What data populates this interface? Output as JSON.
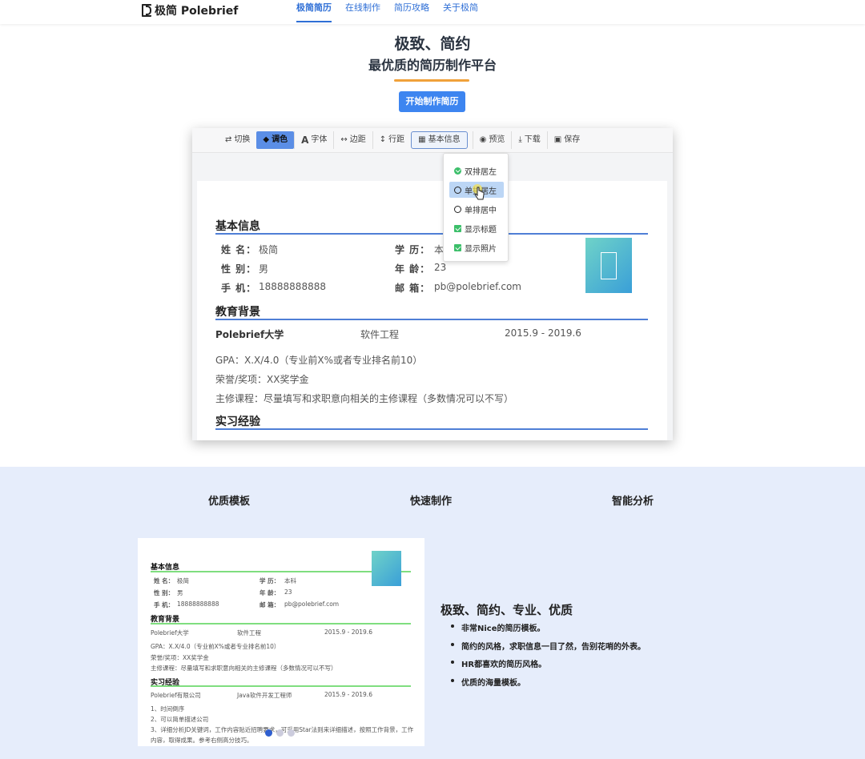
{
  "nav": {
    "logo": "极简 Polebrief",
    "links": [
      "极简简历",
      "在线制作",
      "简历攻略",
      "关于极简"
    ]
  },
  "hero": {
    "title": "极致、简约",
    "subtitle": "最优质的简历制作平台",
    "button": "开始制作简历"
  },
  "toolbar": [
    "切换",
    "调色",
    "字体",
    "边距",
    "行距",
    "基本信息",
    "预览",
    "下载",
    "保存"
  ],
  "dropdown": {
    "items": [
      "双排居左",
      "单排居左",
      "单排居中",
      "显示标题",
      "显示照片"
    ],
    "states": [
      "checked",
      "hover",
      "empty",
      "box-checked",
      "box-checked"
    ]
  },
  "resume": {
    "basic_title": "基本信息",
    "name_label": "姓 名：",
    "name": "极简",
    "edu_label": "学 历：",
    "edu": "本",
    "gender_label": "性 别：",
    "gender": "男",
    "age_label": "年 龄：",
    "age": "23",
    "phone_label": "手 机：",
    "phone": "18888888888",
    "email_label": "邮 箱：",
    "email": "pb@polebrief.com",
    "edu_title": "教育背景",
    "school": "Polebrief大学",
    "major": "软件工程",
    "period": "2015.9 - 2019.6",
    "gpa": "GPA：X.X/4.0（专业前X%或者专业排名前10）",
    "honor": "荣誉/奖项：XX奖学金",
    "courses": "主修课程：尽量填写和求职意向相关的主修课程（多数情况可以不写）",
    "intern_title": "实习经验"
  },
  "features": {
    "items": [
      "优质模板",
      "快速制作",
      "智能分析"
    ]
  },
  "mini": {
    "basic_title": "基本信息",
    "name_label": "姓 名：",
    "name": "极简",
    "edu_label": "学 历：",
    "edu": "本科",
    "gender_label": "性 别：",
    "gender": "男",
    "age_label": "年 龄：",
    "age": "23",
    "phone_label": "手 机：",
    "phone": "18888888888",
    "email_label": "邮 箱：",
    "email": "pb@polebrief.com",
    "edu_title": "教育背景",
    "school": "Polebrief大学",
    "major": "软件工程",
    "period": "2015.9 - 2019.6",
    "gpa": "GPA：X.X/4.0（专业前X%或者专业排名前10）",
    "honor": "荣誉/奖项：XX奖学金",
    "courses": "主修课程：尽量填写和求职意向相关的主修课程（多数情况可以不写）",
    "intern_title": "实习经验",
    "company": "Polebrief有限公司",
    "job": "Java软件开发工程师",
    "job_period": "2015.9 - 2019.6",
    "line1": "1、时间倒序",
    "line2": "2、可以简单描述公司",
    "line3": "3、详细分析JD关键词，工作内容贴近招聘要求，可采用Star法则来详细描述，按照工作背景，工作",
    "line4": "内容，取得成果。参考右侧高分技巧。"
  },
  "description": {
    "title": "极致、简约、专业、优质",
    "points": [
      "非常Nice的简历模板。",
      "简约的风格，求职信息一目了然，告别花哨的外表。",
      "HR都喜欢的简历风格。",
      "优质的海量模板。"
    ]
  },
  "colors": {
    "accent": "#3d85f0",
    "underline": "#f0a13a",
    "rule": "#4f7fd6",
    "band": "#e6edfb"
  }
}
